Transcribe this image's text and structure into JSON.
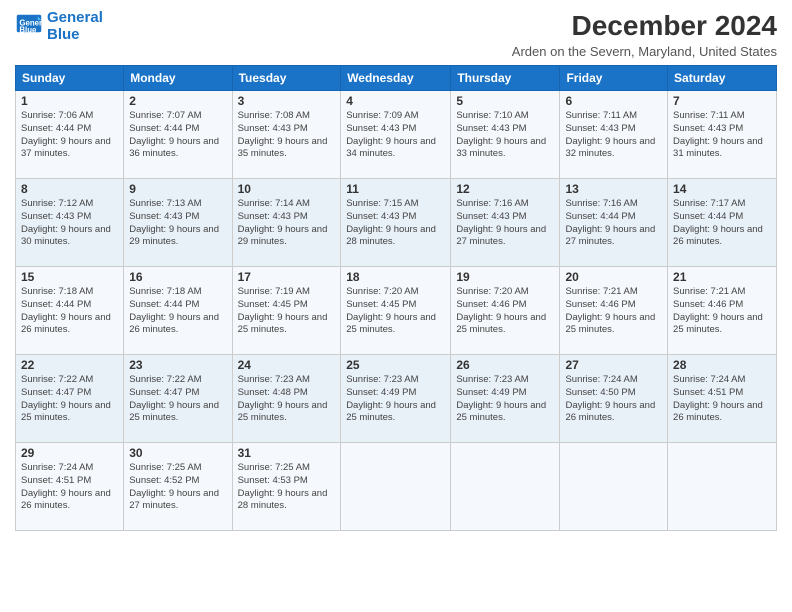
{
  "logo": {
    "line1": "General",
    "line2": "Blue"
  },
  "title": "December 2024",
  "subtitle": "Arden on the Severn, Maryland, United States",
  "weekdays": [
    "Sunday",
    "Monday",
    "Tuesday",
    "Wednesday",
    "Thursday",
    "Friday",
    "Saturday"
  ],
  "weeks": [
    [
      {
        "day": "1",
        "sunrise": "7:06 AM",
        "sunset": "4:44 PM",
        "daylight": "9 hours and 37 minutes."
      },
      {
        "day": "2",
        "sunrise": "7:07 AM",
        "sunset": "4:44 PM",
        "daylight": "9 hours and 36 minutes."
      },
      {
        "day": "3",
        "sunrise": "7:08 AM",
        "sunset": "4:43 PM",
        "daylight": "9 hours and 35 minutes."
      },
      {
        "day": "4",
        "sunrise": "7:09 AM",
        "sunset": "4:43 PM",
        "daylight": "9 hours and 34 minutes."
      },
      {
        "day": "5",
        "sunrise": "7:10 AM",
        "sunset": "4:43 PM",
        "daylight": "9 hours and 33 minutes."
      },
      {
        "day": "6",
        "sunrise": "7:11 AM",
        "sunset": "4:43 PM",
        "daylight": "9 hours and 32 minutes."
      },
      {
        "day": "7",
        "sunrise": "7:11 AM",
        "sunset": "4:43 PM",
        "daylight": "9 hours and 31 minutes."
      }
    ],
    [
      {
        "day": "8",
        "sunrise": "7:12 AM",
        "sunset": "4:43 PM",
        "daylight": "9 hours and 30 minutes."
      },
      {
        "day": "9",
        "sunrise": "7:13 AM",
        "sunset": "4:43 PM",
        "daylight": "9 hours and 29 minutes."
      },
      {
        "day": "10",
        "sunrise": "7:14 AM",
        "sunset": "4:43 PM",
        "daylight": "9 hours and 29 minutes."
      },
      {
        "day": "11",
        "sunrise": "7:15 AM",
        "sunset": "4:43 PM",
        "daylight": "9 hours and 28 minutes."
      },
      {
        "day": "12",
        "sunrise": "7:16 AM",
        "sunset": "4:43 PM",
        "daylight": "9 hours and 27 minutes."
      },
      {
        "day": "13",
        "sunrise": "7:16 AM",
        "sunset": "4:44 PM",
        "daylight": "9 hours and 27 minutes."
      },
      {
        "day": "14",
        "sunrise": "7:17 AM",
        "sunset": "4:44 PM",
        "daylight": "9 hours and 26 minutes."
      }
    ],
    [
      {
        "day": "15",
        "sunrise": "7:18 AM",
        "sunset": "4:44 PM",
        "daylight": "9 hours and 26 minutes."
      },
      {
        "day": "16",
        "sunrise": "7:18 AM",
        "sunset": "4:44 PM",
        "daylight": "9 hours and 26 minutes."
      },
      {
        "day": "17",
        "sunrise": "7:19 AM",
        "sunset": "4:45 PM",
        "daylight": "9 hours and 25 minutes."
      },
      {
        "day": "18",
        "sunrise": "7:20 AM",
        "sunset": "4:45 PM",
        "daylight": "9 hours and 25 minutes."
      },
      {
        "day": "19",
        "sunrise": "7:20 AM",
        "sunset": "4:46 PM",
        "daylight": "9 hours and 25 minutes."
      },
      {
        "day": "20",
        "sunrise": "7:21 AM",
        "sunset": "4:46 PM",
        "daylight": "9 hours and 25 minutes."
      },
      {
        "day": "21",
        "sunrise": "7:21 AM",
        "sunset": "4:46 PM",
        "daylight": "9 hours and 25 minutes."
      }
    ],
    [
      {
        "day": "22",
        "sunrise": "7:22 AM",
        "sunset": "4:47 PM",
        "daylight": "9 hours and 25 minutes."
      },
      {
        "day": "23",
        "sunrise": "7:22 AM",
        "sunset": "4:47 PM",
        "daylight": "9 hours and 25 minutes."
      },
      {
        "day": "24",
        "sunrise": "7:23 AM",
        "sunset": "4:48 PM",
        "daylight": "9 hours and 25 minutes."
      },
      {
        "day": "25",
        "sunrise": "7:23 AM",
        "sunset": "4:49 PM",
        "daylight": "9 hours and 25 minutes."
      },
      {
        "day": "26",
        "sunrise": "7:23 AM",
        "sunset": "4:49 PM",
        "daylight": "9 hours and 25 minutes."
      },
      {
        "day": "27",
        "sunrise": "7:24 AM",
        "sunset": "4:50 PM",
        "daylight": "9 hours and 26 minutes."
      },
      {
        "day": "28",
        "sunrise": "7:24 AM",
        "sunset": "4:51 PM",
        "daylight": "9 hours and 26 minutes."
      }
    ],
    [
      {
        "day": "29",
        "sunrise": "7:24 AM",
        "sunset": "4:51 PM",
        "daylight": "9 hours and 26 minutes."
      },
      {
        "day": "30",
        "sunrise": "7:25 AM",
        "sunset": "4:52 PM",
        "daylight": "9 hours and 27 minutes."
      },
      {
        "day": "31",
        "sunrise": "7:25 AM",
        "sunset": "4:53 PM",
        "daylight": "9 hours and 28 minutes."
      },
      null,
      null,
      null,
      null
    ]
  ]
}
